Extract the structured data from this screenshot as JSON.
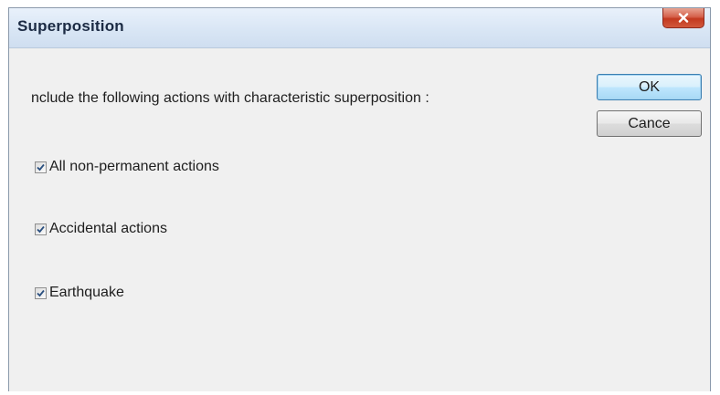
{
  "window": {
    "title": "Superposition",
    "close_icon": "close-icon"
  },
  "prompt": "nclude the following actions with characteristic superposition :",
  "buttons": {
    "ok": "OK",
    "cancel": "Cance"
  },
  "options": [
    {
      "label": "All non-permanent actions",
      "checked": true
    },
    {
      "label": "Accidental actions",
      "checked": true
    },
    {
      "label": "Earthquake",
      "checked": true
    }
  ],
  "colors": {
    "accent": "#3c7fb1",
    "close_button": "#c3391f",
    "check_mark": "#2a4f7f"
  }
}
